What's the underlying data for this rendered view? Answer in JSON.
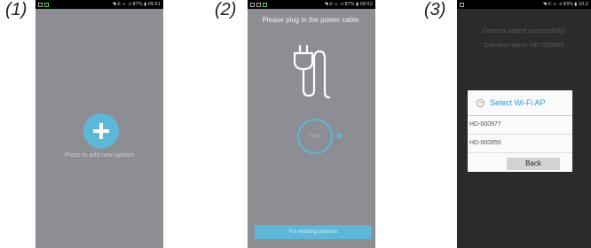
{
  "labels": {
    "step1": "(1)",
    "step2": "(2)",
    "step3": "(3)"
  },
  "phone1": {
    "status_right": "◥ ✆ ≈ .ıl 87% ▮ 09:51",
    "add_caption": "Press to add new system"
  },
  "phone2": {
    "status_right": "◥ ✆ ≈ .ıl 87% ▮ 09:52",
    "title": "Please plug in the power cable.",
    "next_label": "Next",
    "existing_button": "For existing systems"
  },
  "phone3": {
    "status_right": "◥ ✆ ≈ .ıl 83% ▮ 10:2",
    "camera_added": "Camera added successfully!",
    "camera_name": "Camera name: HD-000955",
    "dialog_title": "Select Wi-Fi AP",
    "ap_items": [
      "HD-000977",
      "HD-000955"
    ],
    "back_button": "Back"
  },
  "colors": {
    "accent": "#5db7d9",
    "screen_gray": "#8d8e93",
    "dark_bg": "#2b2b2b"
  }
}
